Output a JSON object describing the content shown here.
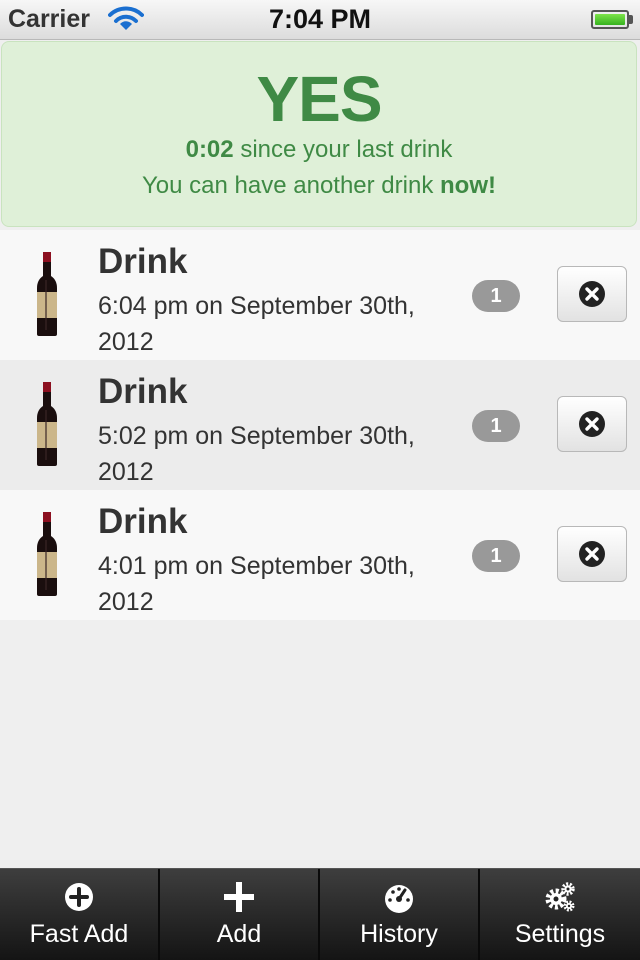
{
  "status_bar": {
    "carrier": "Carrier",
    "time": "7:04 PM",
    "wifi_icon": "wifi-icon",
    "battery_icon": "battery-icon"
  },
  "status": {
    "answer": "YES",
    "elapsed": "0:02",
    "since_text": "since your last drink",
    "advice_text": "You can have another drink",
    "advice_emphasis": "now!",
    "color": "#3f8a45",
    "background": "#dff0d8"
  },
  "drinks": [
    {
      "icon": "wine-bottle-icon",
      "title": "Drink",
      "time": "6:04 pm on September 30th, 2012",
      "count": "1"
    },
    {
      "icon": "wine-bottle-icon",
      "title": "Drink",
      "time": "5:02 pm on September 30th, 2012",
      "count": "1"
    },
    {
      "icon": "wine-bottle-icon",
      "title": "Drink",
      "time": "4:01 pm on September 30th, 2012",
      "count": "1"
    }
  ],
  "delete_icon": "close-circle-icon",
  "tabs": [
    {
      "label": "Fast Add",
      "icon": "plus-circle-icon"
    },
    {
      "label": "Add",
      "icon": "plus-icon"
    },
    {
      "label": "History",
      "icon": "gauge-icon"
    },
    {
      "label": "Settings",
      "icon": "gears-icon"
    }
  ]
}
